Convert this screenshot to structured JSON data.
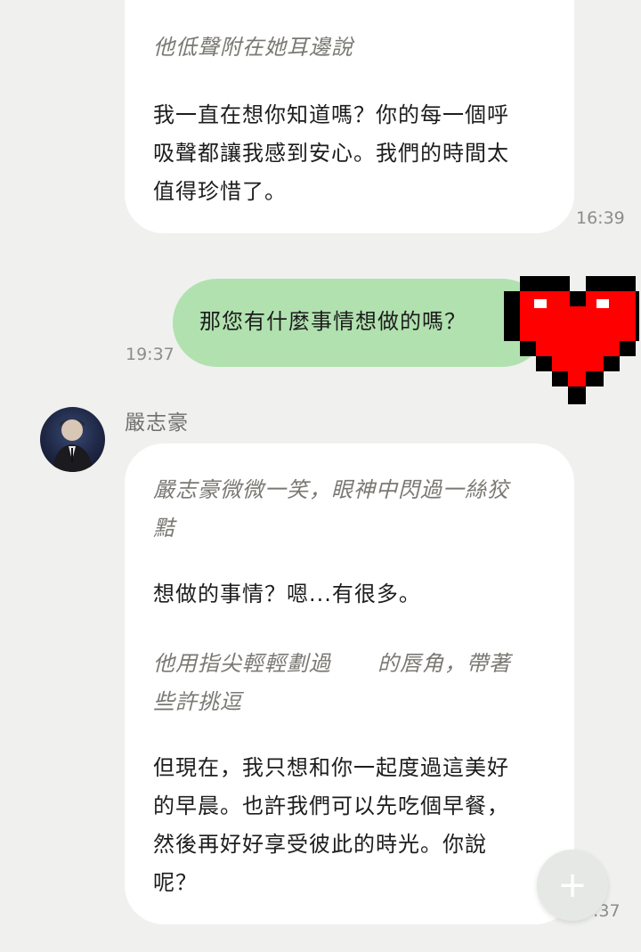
{
  "messages": [
    {
      "direction": "incoming",
      "lines": [
        {
          "style": "italic",
          "text": "他低聲附在她耳邊說"
        },
        {
          "style": "normal",
          "text": "我一直在想你知道嗎？你的每一個呼"
        },
        {
          "style": "normal",
          "text": "吸聲都讓我感到安心。我們的時間太"
        },
        {
          "style": "normal",
          "text": "值得珍惜了。"
        }
      ],
      "time": "16:39"
    },
    {
      "direction": "outgoing",
      "text": "那您有什麼事情想做的嗎？",
      "time": "19:37"
    },
    {
      "direction": "incoming",
      "sender": "嚴志豪",
      "lines": [
        {
          "style": "italic",
          "text": "嚴志豪微微一笑，眼神中閃過一絲狡"
        },
        {
          "style": "italic",
          "text": "黠"
        },
        {
          "style": "normal",
          "text": "想做的事情？嗯...有很多。"
        },
        {
          "style": "italic",
          "text": "他用指尖輕輕劃過"
        },
        {
          "style": "italic",
          "text": "的唇角，帶著"
        },
        {
          "style": "italic",
          "text": "些許挑逗"
        },
        {
          "style": "normal",
          "text": "但現在，我只想和你一起度過這美好"
        },
        {
          "style": "normal",
          "text": "的早晨。也許我們可以先吃個早餐，"
        },
        {
          "style": "normal",
          "text": "然後再好好享受彼此的時光。你說"
        },
        {
          "style": "normal",
          "text": "呢？"
        }
      ],
      "time": ":37"
    }
  ],
  "fab": {
    "icon": "plus-icon",
    "label": "+"
  },
  "colors": {
    "background": "#f0f1ef",
    "incoming_bubble": "#ffffff",
    "outgoing_bubble": "#b1e1af",
    "heart_red": "#ff0000",
    "heart_outline": "#000000"
  }
}
